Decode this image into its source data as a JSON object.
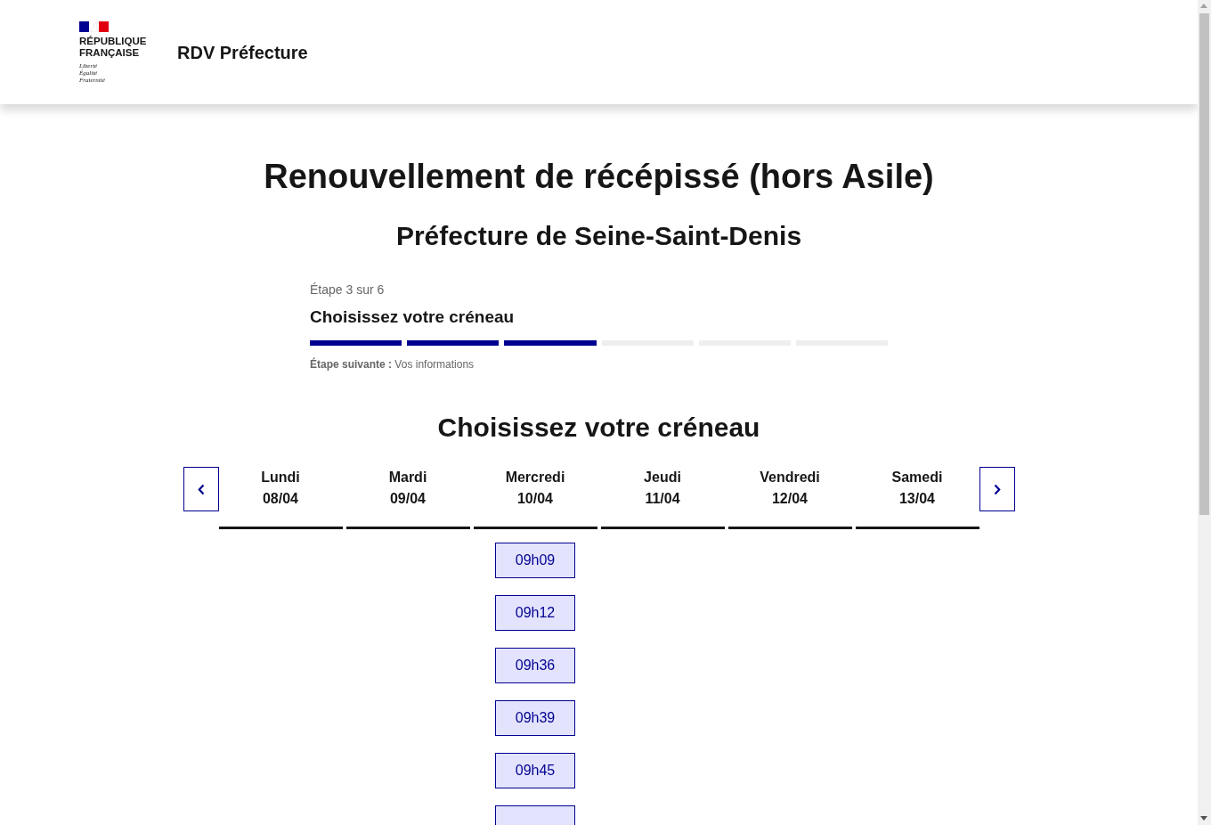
{
  "header": {
    "logo_lines": [
      "RÉPUBLIQUE",
      "FRANÇAISE"
    ],
    "motto": [
      "Liberté",
      "Égalité",
      "Fraternité"
    ],
    "service_title": "RDV Préfecture"
  },
  "page_title": "Renouvellement de récépissé (hors Asile)",
  "prefecture": "Préfecture de Seine-Saint-Denis",
  "stepper": {
    "count": "Étape 3 sur 6",
    "title": "Choisissez votre créneau",
    "steps": [
      {
        "completed": true
      },
      {
        "completed": true
      },
      {
        "completed": true
      },
      {
        "completed": false
      },
      {
        "completed": false
      },
      {
        "completed": false
      }
    ],
    "next": "**Étape suivante :** Vos informations"
  },
  "slots_section": {
    "title": "Choisissez votre créneau",
    "days": [
      {
        "name": "Lundi",
        "date": "08/04"
      },
      {
        "name": "Mardi",
        "date": "09/04"
      },
      {
        "name": "Mercredi",
        "date": "10/04",
        "slots": [
          "09h09",
          "09h12",
          "09h36",
          "09h39",
          "09h45"
        ],
        "cut_off_slot": true
      },
      {
        "name": "Jeudi",
        "date": "11/04"
      },
      {
        "name": "Vendredi",
        "date": "12/04"
      },
      {
        "name": "Samedi",
        "date": "13/04"
      }
    ]
  }
}
